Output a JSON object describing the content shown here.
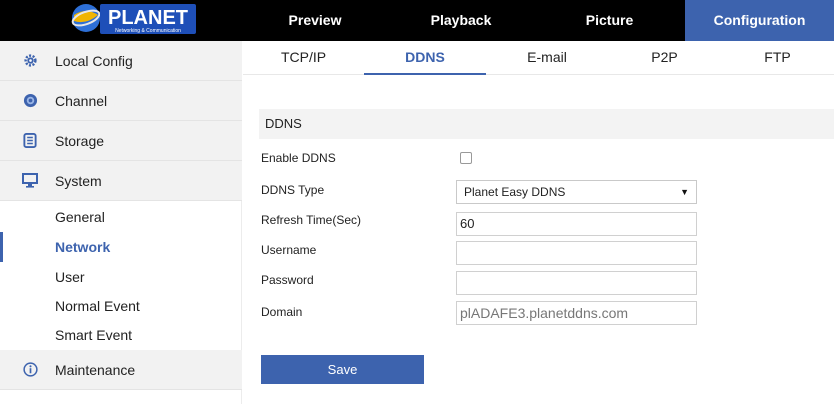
{
  "logo": {
    "text": "PLANET",
    "tagline": "Networking & Communication"
  },
  "nav": {
    "tabs": [
      {
        "label": "Preview"
      },
      {
        "label": "Playback"
      },
      {
        "label": "Picture"
      },
      {
        "label": "Configuration",
        "active": true
      }
    ]
  },
  "sidebar": {
    "groups": [
      {
        "label": "Local Config",
        "icon": "gear-icon"
      },
      {
        "label": "Channel",
        "icon": "channel-icon"
      },
      {
        "label": "Storage",
        "icon": "storage-icon"
      },
      {
        "label": "System",
        "icon": "monitor-icon"
      },
      {
        "label": "Maintenance",
        "icon": "info-icon"
      }
    ],
    "system_items": [
      {
        "label": "General"
      },
      {
        "label": "Network",
        "active": true
      },
      {
        "label": "User"
      },
      {
        "label": "Normal Event"
      },
      {
        "label": "Smart Event"
      }
    ]
  },
  "subtabs": [
    {
      "label": "TCP/IP"
    },
    {
      "label": "DDNS",
      "active": true
    },
    {
      "label": "E-mail"
    },
    {
      "label": "P2P"
    },
    {
      "label": "FTP"
    }
  ],
  "section": {
    "title": "DDNS"
  },
  "form": {
    "enable_label": "Enable DDNS",
    "enable_checked": false,
    "type_label": "DDNS Type",
    "type_value": "Planet Easy DDNS",
    "refresh_label": "Refresh Time(Sec)",
    "refresh_value": "60",
    "username_label": "Username",
    "username_value": "",
    "password_label": "Password",
    "password_value": "",
    "domain_label": "Domain",
    "domain_value": "plADAFE3.planetddns.com"
  },
  "save_label": "Save",
  "colors": {
    "accent": "#3d63ae",
    "topbar": "#000000",
    "sidebar_group": "#f2f2f2",
    "section_bar": "#f3f3f3"
  }
}
